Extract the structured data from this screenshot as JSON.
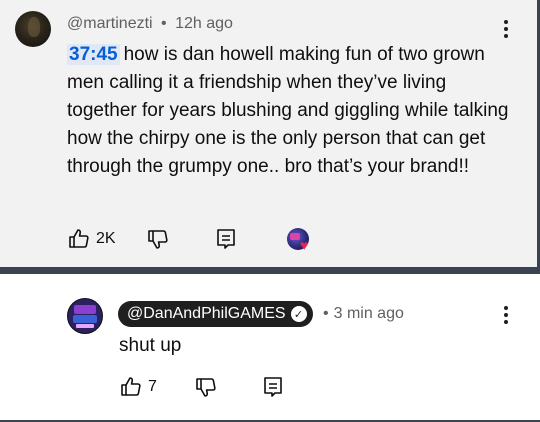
{
  "comment": {
    "handle": "@martinezti",
    "separator": "•",
    "age": "12h ago",
    "timestamp_link": "37:45",
    "text": "how is dan howell making fun of two grown men calling it a friendship when they’ve living together for years blushing and giggling while talking how the chirpy one is the only person that can get through the grumpy one.. bro that’s your brand!!",
    "likes": "2K",
    "icons": {
      "like": "thumbs-up-icon",
      "dislike": "thumbs-down-icon",
      "reply": "reply-icon",
      "creator_heart": "creator-heart-icon",
      "more": "more-vertical-icon"
    }
  },
  "reply": {
    "handle": "@DanAndPhilGAMES",
    "separator": "•",
    "age": "3 min ago",
    "text": "shut up",
    "likes": "7",
    "icons": {
      "verified": "verified-check-icon",
      "like": "thumbs-up-icon",
      "dislike": "thumbs-down-icon",
      "reply": "reply-icon",
      "more": "more-vertical-icon"
    }
  },
  "colors": {
    "link": "#065fd4",
    "heart": "#e0245e",
    "owner_badge_bg": "#1f1f1f",
    "frame": "#3b4252"
  }
}
